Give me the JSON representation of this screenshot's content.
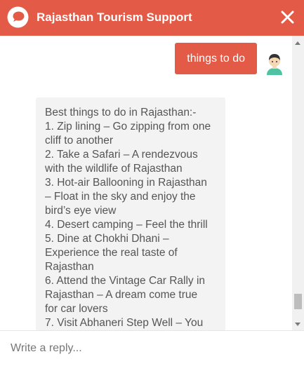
{
  "header": {
    "title": "Rajasthan Tourism Support",
    "logo_icon": "chat-bubble-icon",
    "close_icon": "close-icon",
    "accent_color": "#e35a47"
  },
  "messages": {
    "user": {
      "text": "things to do",
      "avatar_icon": "user-avatar-icon"
    },
    "bot": {
      "lines": [
        "Best things to do in Rajasthan:-",
        "1. Zip lining – Go zipping from one",
        "cliff to another",
        "2. Take a Safari – A rendezvous",
        "with the wildlife of Rajasthan",
        "3. Hot-air Ballooning in Rajasthan",
        "– Float in the sky and enjoy the",
        "bird’s eye view",
        "4. Desert camping – Feel the thrill",
        "5. Dine at Chokhi Dhani –",
        "Experience the real taste of",
        "Rajasthan",
        "6. Attend the Vintage Car Rally in",
        "Rajasthan – A dream come true",
        "for car lovers",
        "7. Visit Abhaneri Step Well – You"
      ]
    }
  },
  "composer": {
    "placeholder": "Write a reply..."
  }
}
